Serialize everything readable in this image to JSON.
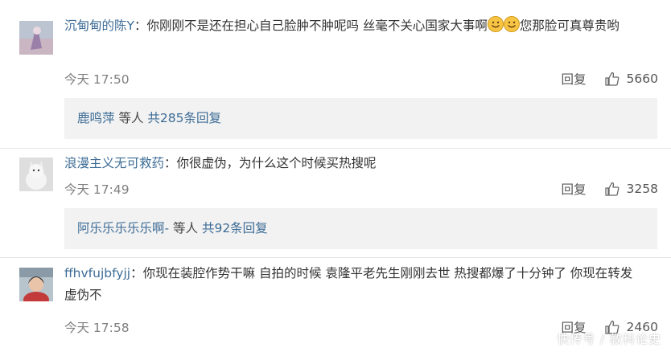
{
  "comments": [
    {
      "username": "沉甸甸的陈Y",
      "separator": "：",
      "text_before": "你刚刚不是还在担心自己脸肿不肿呢吗 丝毫不关心国家大事啊",
      "emoji_count": 2,
      "text_after": "您那脸可真尊贵哟",
      "time": "今天 17:50",
      "reply_label": "回复",
      "likes": "5660",
      "reply_preview": {
        "name": "鹿鸣萍",
        "middle": " 等人 ",
        "total": "共285条回复"
      }
    },
    {
      "username": "浪漫主义无可救药",
      "separator": "：",
      "text_before": "你很虚伪，为什么这个时候买热搜呢",
      "time": "今天 17:49",
      "reply_label": "回复",
      "likes": "3258",
      "reply_preview": {
        "name": "阿乐乐乐乐乐啊-",
        "middle": " 等人 ",
        "total": "共92条回复"
      }
    },
    {
      "username": "ffhvfujbfyjj",
      "separator": "：",
      "text_before": "你现在装腔作势干嘛  自拍的时候 袁隆平老先生刚刚去世  热搜都爆了十分钟了  你现在转发  虚伪不",
      "time": "今天 17:58",
      "reply_label": "回复",
      "likes": "2460"
    }
  ],
  "watermark": "快传号 / 教科论史",
  "colors": {
    "username": "#3d6c96",
    "reply_bar_bg": "#f2f2f2",
    "meta": "#808080"
  },
  "icons": {
    "like": "thumbs-up-icon",
    "emoji": "smiley-icon"
  }
}
